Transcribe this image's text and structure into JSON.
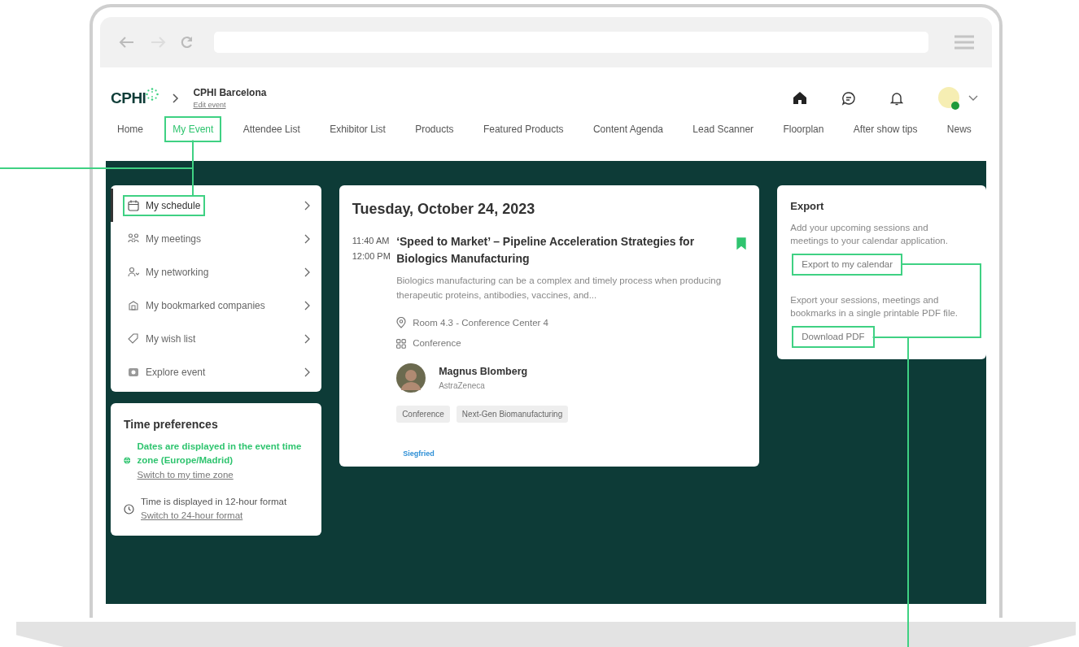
{
  "header": {
    "logo": "CPHI",
    "event_name": "CPHI Barcelona",
    "edit_link": "Edit event"
  },
  "nav_tabs": [
    {
      "label": "Home",
      "selected": false,
      "highlighted": false
    },
    {
      "label": "My Event",
      "selected": true,
      "highlighted": true
    },
    {
      "label": "Attendee List",
      "selected": false,
      "highlighted": false
    },
    {
      "label": "Exhibitor List",
      "selected": false,
      "highlighted": false
    },
    {
      "label": "Products",
      "selected": false,
      "highlighted": false
    },
    {
      "label": "Featured Products",
      "selected": false,
      "highlighted": false
    },
    {
      "label": "Content Agenda",
      "selected": false,
      "highlighted": false
    },
    {
      "label": "Lead Scanner",
      "selected": false,
      "highlighted": false
    },
    {
      "label": "Floorplan",
      "selected": false,
      "highlighted": false
    },
    {
      "label": "After show tips",
      "selected": false,
      "highlighted": false
    },
    {
      "label": "News",
      "selected": false,
      "highlighted": false
    }
  ],
  "menu": [
    {
      "label": "My schedule",
      "selected": true,
      "highlighted": true
    },
    {
      "label": "My meetings",
      "selected": false,
      "highlighted": false
    },
    {
      "label": "My networking",
      "selected": false,
      "highlighted": false
    },
    {
      "label": "My bookmarked companies",
      "selected": false,
      "highlighted": false
    },
    {
      "label": "My wish list",
      "selected": false,
      "highlighted": false
    },
    {
      "label": "Explore event",
      "selected": false,
      "highlighted": false
    }
  ],
  "time_preferences": {
    "title": "Time preferences",
    "items": [
      {
        "kind": "timezone",
        "text": "Dates are displayed in the event time zone (Europe/Madrid)",
        "link": "Switch to my time zone"
      },
      {
        "kind": "format",
        "text": "Time is displayed in 12-hour format",
        "link": "Switch to 24-hour format"
      }
    ]
  },
  "session": {
    "date": "Tuesday, October 24, 2023",
    "start": "11:40 AM",
    "end": "12:00 PM",
    "title": "‘Speed to Market’ – Pipeline Acceleration Strategies for Biologics Manufacturing",
    "bookmarked": true,
    "description": "Biologics manufacturing can be a complex and timely process when producing therapeutic proteins, antibodies, vaccines, and...",
    "location": "Room 4.3 - Conference Center 4",
    "type": "Conference",
    "speaker": {
      "name": "Magnus Blomberg",
      "company": "AstraZeneca"
    },
    "tags": [
      "Conference",
      "Next-Gen Biomanufacturing"
    ],
    "sponsor": "Siegfried"
  },
  "export": {
    "title": "Export",
    "sections": [
      {
        "text": "Add your upcoming sessions and meetings to your calendar application.",
        "button": "Export to my calendar",
        "highlighted": true
      },
      {
        "text": "Export your sessions, meetings and bookmarks in a single printable PDF file.",
        "button": "Download PDF",
        "highlighted": true
      }
    ]
  }
}
